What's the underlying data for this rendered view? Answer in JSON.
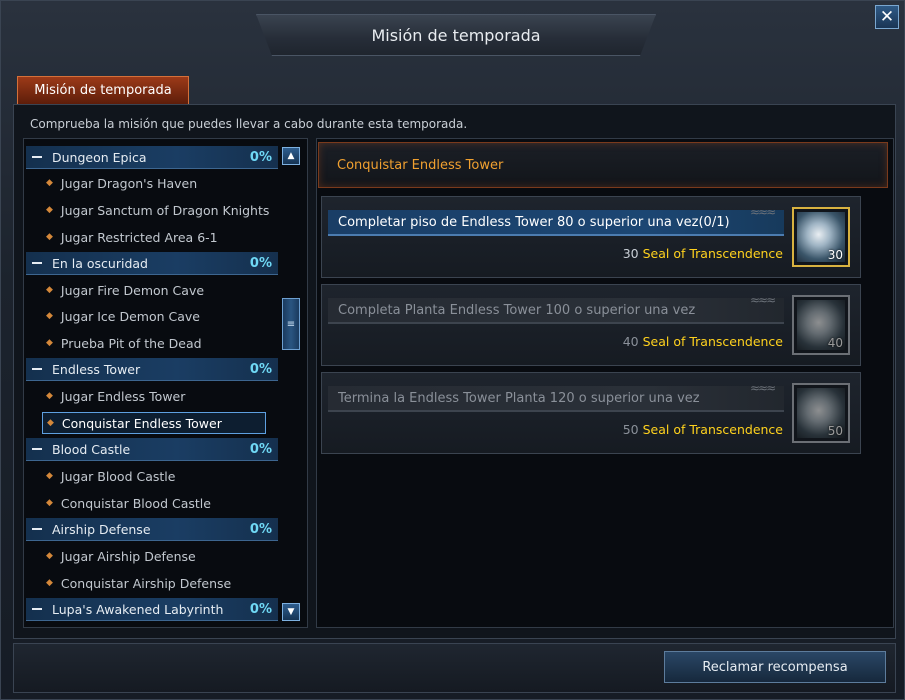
{
  "window": {
    "title": "Misión de temporada"
  },
  "tab": {
    "label": "Misión de temporada"
  },
  "description": "Comprueba la misión que puedes llevar a cabo durante esta temporada.",
  "categories": [
    {
      "name": "Dungeon Epica",
      "pct": "0%",
      "subs": [
        "Jugar Dragon's Haven",
        "Jugar Sanctum of Dragon Knights",
        "Jugar Restricted Area 6-1"
      ]
    },
    {
      "name": "En la oscuridad",
      "pct": "0%",
      "subs": [
        "Jugar Fire Demon Cave",
        "Jugar Ice Demon Cave",
        "Prueba Pit of the Dead"
      ]
    },
    {
      "name": "Endless Tower",
      "pct": "0%",
      "subs": [
        "Jugar Endless Tower",
        "Conquistar Endless Tower"
      ]
    },
    {
      "name": "Blood Castle",
      "pct": "0%",
      "subs": [
        "Jugar Blood Castle",
        "Conquistar Blood Castle"
      ]
    },
    {
      "name": "Airship Defense",
      "pct": "0%",
      "subs": [
        "Jugar Airship Defense",
        "Conquistar Airship Defense"
      ]
    },
    {
      "name": "Lupa's Awakened Labyrinth",
      "pct": "0%",
      "subs": []
    }
  ],
  "selected_mission": "Conquistar Endless Tower",
  "quests": [
    {
      "title": "Completar piso de Endless Tower 80 o superior una vez(0/1)",
      "reward_amount": "30",
      "reward_item": "Seal of Transcendence",
      "icon_count": "30",
      "state": "active"
    },
    {
      "title": "Completa Planta Endless Tower 100 o superior una vez",
      "reward_amount": "40",
      "reward_item": "Seal of Transcendence",
      "icon_count": "40",
      "state": "inactive"
    },
    {
      "title": "Termina la Endless Tower Planta 120 o superior una vez",
      "reward_amount": "50",
      "reward_item": "Seal of Transcendence",
      "icon_count": "50",
      "state": "inactive"
    }
  ],
  "footer": {
    "claim_label": "Reclamar recompensa"
  },
  "icons": {
    "close": "close-icon",
    "scroll_up": "arrow-up-icon",
    "scroll_down": "arrow-down-icon",
    "scroll_thumb": "grip-icon",
    "seal": "seal-icon"
  },
  "colors": {
    "accent_orange": "#f0a030",
    "progress_cyan": "#6fd8f5",
    "reward_yellow": "#ffd21e",
    "tab_red": "#9c3a18"
  }
}
